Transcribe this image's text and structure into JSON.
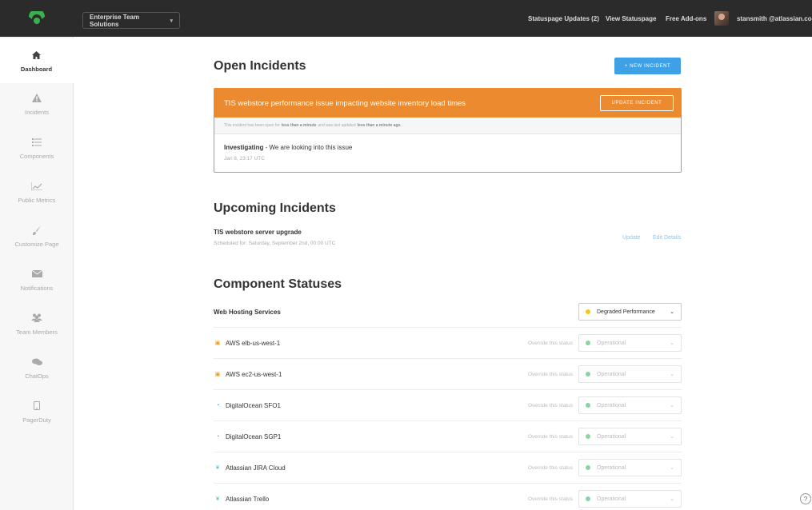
{
  "topbar": {
    "org_name": "Enterprise Team Solutions",
    "nav": {
      "updates": "Statuspage Updates (2)",
      "view": "View Statuspage",
      "addons": "Free Add-ons"
    },
    "user_email": "stansmith @atlassian.com"
  },
  "sidebar": {
    "items": [
      {
        "label": "Dashboard",
        "icon": "home-icon"
      },
      {
        "label": "Incidents",
        "icon": "warning-icon"
      },
      {
        "label": "Components",
        "icon": "list-icon"
      },
      {
        "label": "Public Metrics",
        "icon": "chart-icon"
      },
      {
        "label": "Customize Page",
        "icon": "brush-icon"
      },
      {
        "label": "Notifications",
        "icon": "envelope-icon"
      },
      {
        "label": "Team Members",
        "icon": "team-icon"
      },
      {
        "label": "ChatOps",
        "icon": "chat-icon"
      },
      {
        "label": "PagerDuty",
        "icon": "phone-icon"
      }
    ]
  },
  "open_incidents": {
    "heading": "Open Incidents",
    "new_button": "+ NEW INCIDENT",
    "incident": {
      "title": "TIS webstore performance issue impacting website inventory load times",
      "update_button": "UPDATE INCIDENT",
      "note_prefix": "This incident has been open for",
      "note_open": "less than a minute",
      "note_mid": "and was last updated",
      "note_updated": "less than a minute ago",
      "note_suffix": ".",
      "status": "Investigating",
      "message": " - We are looking into this issue",
      "time": "Jan 8, 23:17 UTC"
    }
  },
  "upcoming": {
    "heading": "Upcoming Incidents",
    "name": "TIS webstore server upgrade",
    "schedule": "Scheduled for: Saturday, September 2nd, 00:00 UTC",
    "update_link": "Update",
    "edit_link": "Edit Details"
  },
  "components": {
    "heading": "Component Statuses",
    "override_label": "Override this status",
    "colors": {
      "degraded": "#f5c518",
      "operational": "#8bd3a3",
      "accent": "#ec8a2f",
      "brand": "#3ea1e6"
    },
    "group": {
      "name": "Web Hosting Services",
      "status": "Degraded Performance"
    },
    "rows": [
      {
        "name": "AWS elb-us-west-1",
        "icon": "aws-icon",
        "status": "Operational"
      },
      {
        "name": "AWS ec2-us-west-1",
        "icon": "aws-icon",
        "status": "Operational"
      },
      {
        "name": "DigitalOcean SFO1",
        "icon": "digitalocean-icon",
        "status": "Operational"
      },
      {
        "name": "DigitalOcean SGP1",
        "icon": "digitalocean-icon",
        "status": "Operational"
      },
      {
        "name": "Atlassian JIRA Cloud",
        "icon": "atlassian-icon",
        "status": "Operational"
      },
      {
        "name": "Atlassian Trello",
        "icon": "atlassian-icon",
        "status": "Operational"
      }
    ]
  },
  "help": "?"
}
